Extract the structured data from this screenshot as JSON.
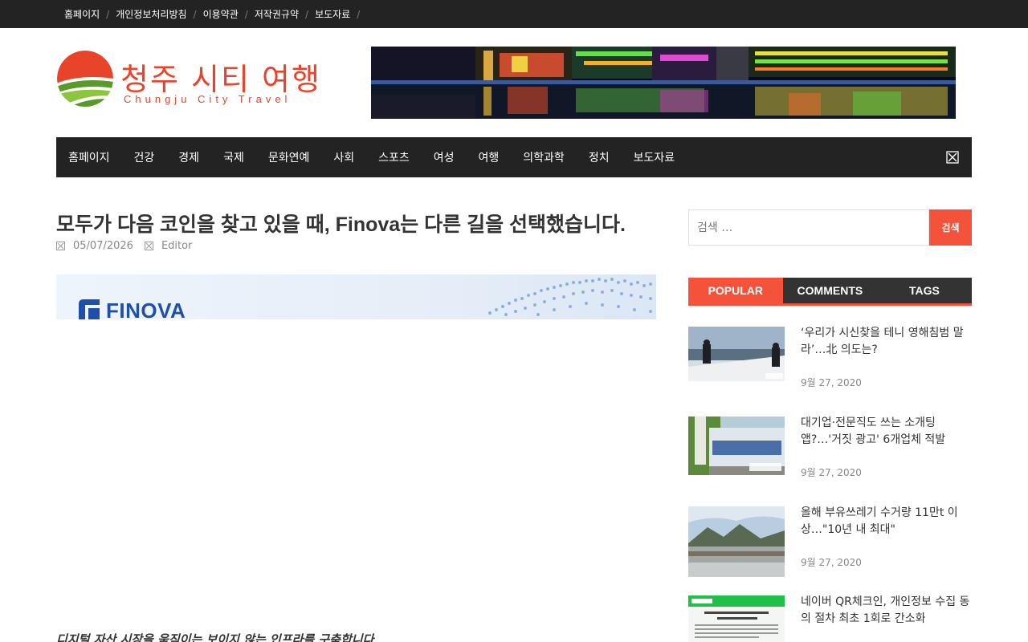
{
  "topbar": {
    "items": [
      "홈페이지",
      "개인정보처리방침",
      "이용약관",
      "저작권규약",
      "보도자료"
    ]
  },
  "logo": {
    "title": "청주 시티 여행",
    "subtitle": "Chungju City Travel"
  },
  "mainnav": {
    "items": [
      "홈페이지",
      "건강",
      "경제",
      "국제",
      "문화연예",
      "사회",
      "스포츠",
      "여성",
      "여행",
      "의학과학",
      "정치",
      "보도자료"
    ],
    "search_icon": "close-box-icon"
  },
  "article": {
    "title": "모두가 다음 코인을 찾고 있을 때, Finova는 다른 길을 선택했습니다.",
    "date": "05/07/2026",
    "author": "Editor",
    "featured_logo_text": "FINOVA",
    "excerpt": "디지털 자산 시장을 움직이는 보이지 않는 인프라를 구축합니다"
  },
  "sidebar": {
    "search_placeholder": "검색 …",
    "search_button": "검색",
    "tabs": [
      "POPULAR",
      "COMMENTS",
      "TAGS"
    ],
    "posts": [
      {
        "title": "‘우리가 시신찾을 테니 영해침범 말라’…北 의도는?",
        "date": "9월 27, 2020"
      },
      {
        "title": "대기업·전문직도 쓰는 소개팅 앱?…'거짓 광고' 6개업체 적발",
        "date": "9월 27, 2020"
      },
      {
        "title": "올해 부유쓰레기 수거량 11만t 이상…\"10년 내 최대\"",
        "date": "9월 27, 2020"
      },
      {
        "title": "네이버 QR체크인, 개인정보 수집 동의 절차 최초 1회로 간소화",
        "date": ""
      }
    ]
  },
  "colors": {
    "accent": "#f4523b",
    "dark_bar": "#232323",
    "logo_red": "#e8442a",
    "logo_green": "#5a9a2a"
  }
}
